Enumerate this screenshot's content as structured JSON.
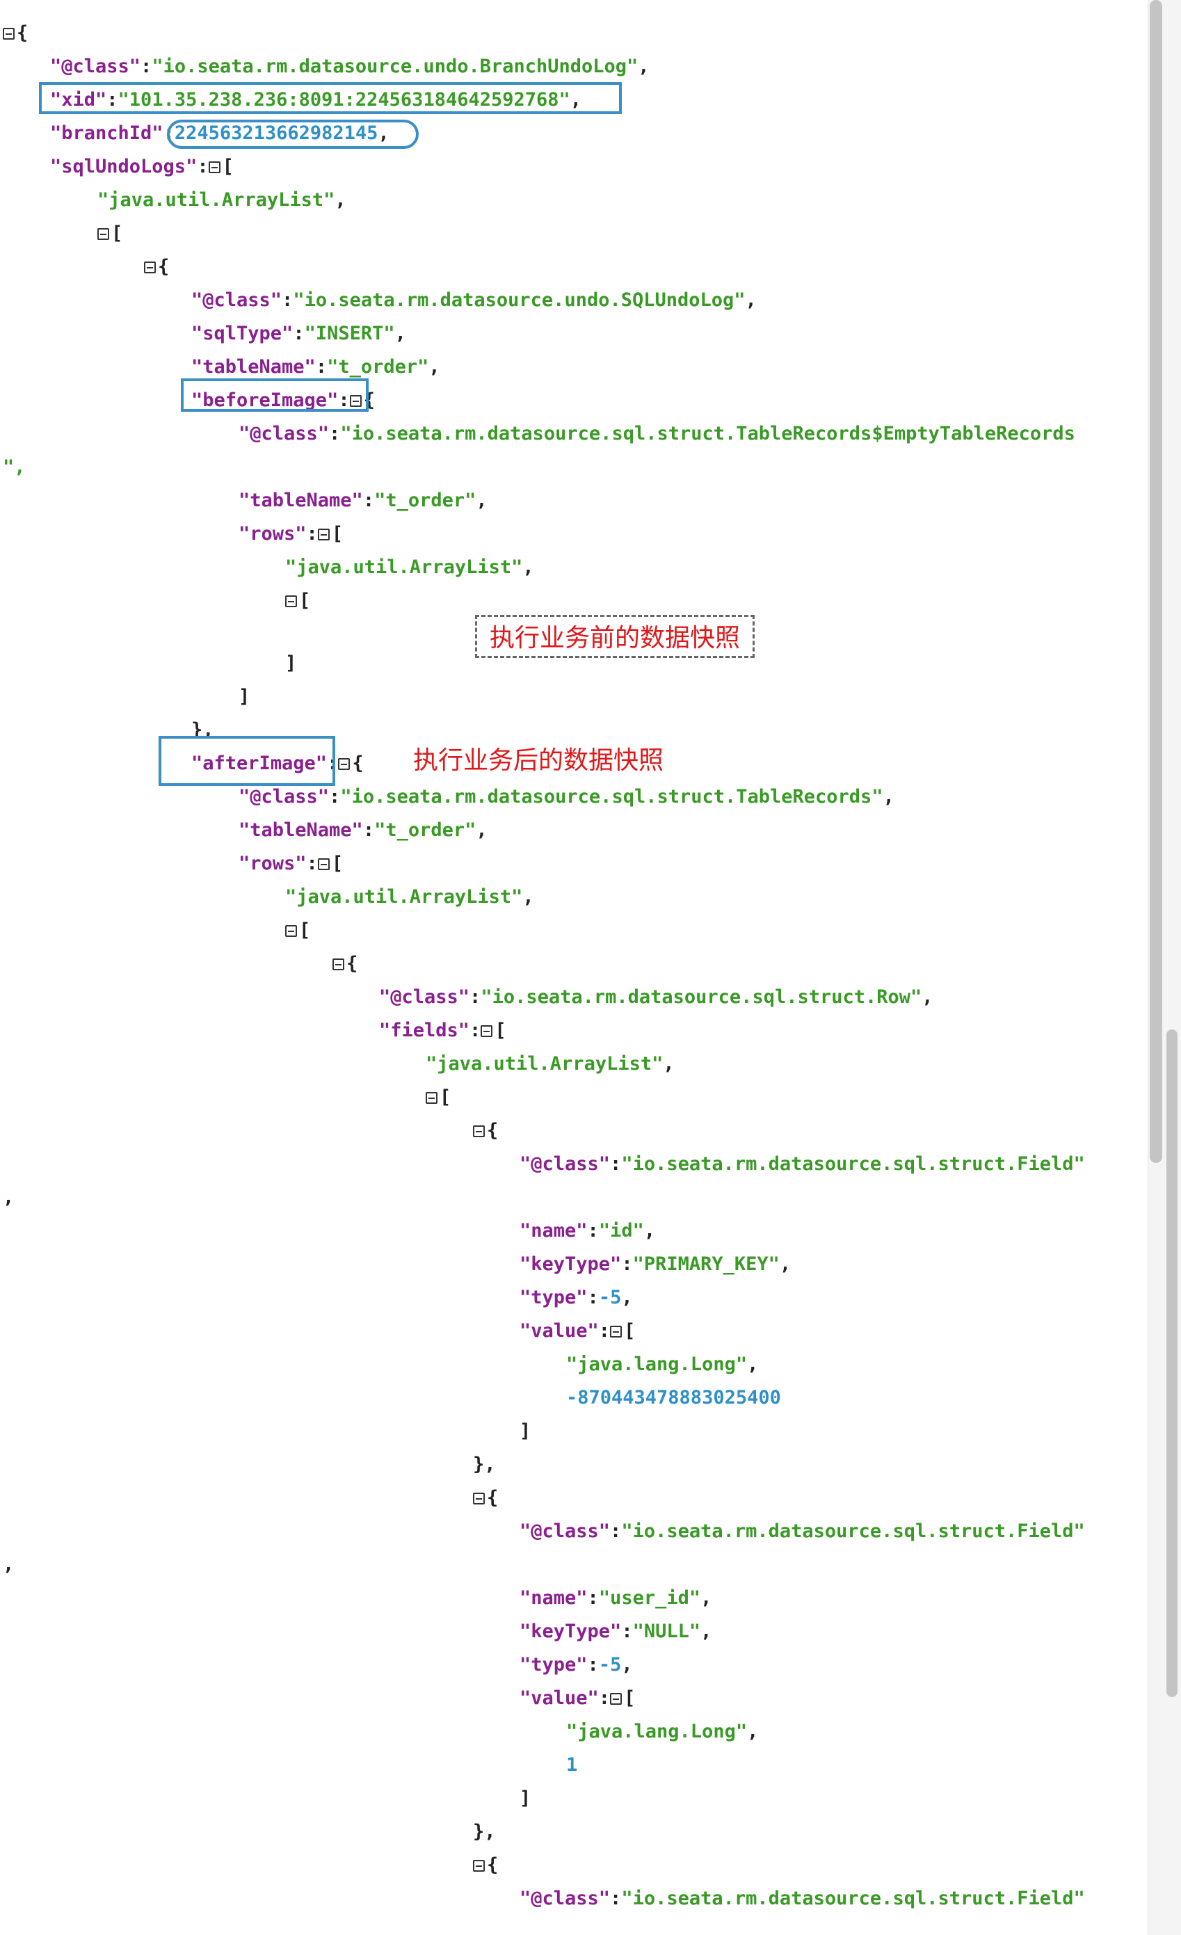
{
  "json": {
    "root_open": "{",
    "root_class_key": "\"@class\"",
    "root_class_val": "\"io.seata.rm.datasource.undo.BranchUndoLog\"",
    "xid_key": "\"xid\"",
    "xid_val": "\"101.35.238.236:8091:224563184642592768\"",
    "branch_key": "\"branchId\"",
    "branch_val": "224563213662982145",
    "sqlundo_key": "\"sqlUndoLogs\"",
    "arraylist_str": "\"java.util.ArrayList\"",
    "sql_class_val": "\"io.seata.rm.datasource.undo.SQLUndoLog\"",
    "sqltype_key": "\"sqlType\"",
    "sqltype_val": "\"INSERT\"",
    "tablename_key": "\"tableName\"",
    "tablename_val": "\"t_order\"",
    "before_key": "\"beforeImage\"",
    "empty_class_val": "\"io.seata.rm.datasource.sql.struct.TableRecords$EmptyTableRecords",
    "wrap_quote_comma": "\",",
    "rows_key": "\"rows\"",
    "after_key": "\"afterImage\"",
    "tr_class_val": "\"io.seata.rm.datasource.sql.struct.TableRecords\"",
    "row_class_val": "\"io.seata.rm.datasource.sql.struct.Row\"",
    "fields_key": "\"fields\"",
    "field_class_val": "\"io.seata.rm.datasource.sql.struct.Field\"",
    "wrap_comma": ",",
    "name_key": "\"name\"",
    "f1_name": "\"id\"",
    "keytype_key": "\"keyType\"",
    "f1_keytype": "\"PRIMARY_KEY\"",
    "type_key": "\"type\"",
    "type_val": "-5",
    "value_key": "\"value\"",
    "long_str": "\"java.lang.Long\"",
    "f1_value": "-870443478883025400",
    "f2_name": "\"user_id\"",
    "f2_keytype": "\"NULL\"",
    "f2_value": "1"
  },
  "annotations": {
    "before_snapshot": "执行业务前的数据快照",
    "after_snapshot": "执行业务后的数据快照"
  },
  "colors": {
    "key": "#8a1f8f",
    "string": "#3a9a26",
    "number": "#2f8fc8",
    "highlight_box": "#3b8fc6",
    "annotation": "#e0181a"
  }
}
